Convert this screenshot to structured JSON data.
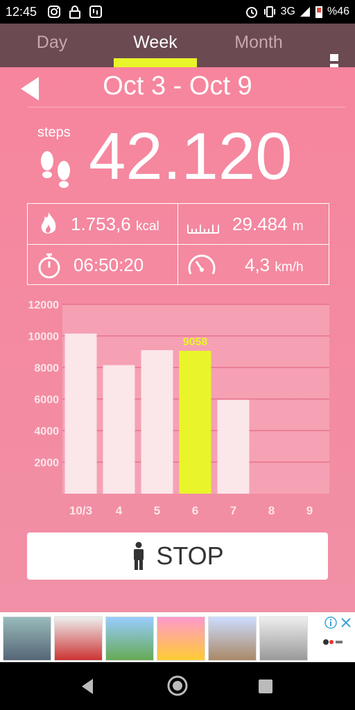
{
  "status_bar": {
    "time": "12:45",
    "network": "3G",
    "battery": "%46"
  },
  "tabs": [
    {
      "label": "Day",
      "active": false
    },
    {
      "label": "Week",
      "active": true
    },
    {
      "label": "Month",
      "active": false
    }
  ],
  "header": {
    "date_range": "Oct 3 - Oct 9"
  },
  "summary": {
    "steps_label": "steps",
    "steps_value": "42.120",
    "calories": "1.753,6",
    "calories_unit": "kcal",
    "distance": "29.484",
    "distance_unit": "m",
    "duration": "06:50:20",
    "speed": "4,3",
    "speed_unit": "km/h"
  },
  "chart_data": {
    "type": "bar",
    "categories": [
      "10/3",
      "4",
      "5",
      "6",
      "7",
      "8",
      "9"
    ],
    "values": [
      10150,
      8150,
      9100,
      9058,
      5950,
      0,
      0
    ],
    "highlight_index": 3,
    "highlight_label": "9058",
    "yticks": [
      2000,
      4000,
      6000,
      8000,
      10000,
      12000
    ],
    "ylim": [
      0,
      12000
    ],
    "grid": true,
    "bar_color": "#fbe6ea",
    "highlight_color": "#e9f52a"
  },
  "stop_button": {
    "label": "STOP"
  },
  "colors": {
    "background": "#f2869f",
    "tabbar": "#6b4a52",
    "accent": "#e9f52a"
  }
}
